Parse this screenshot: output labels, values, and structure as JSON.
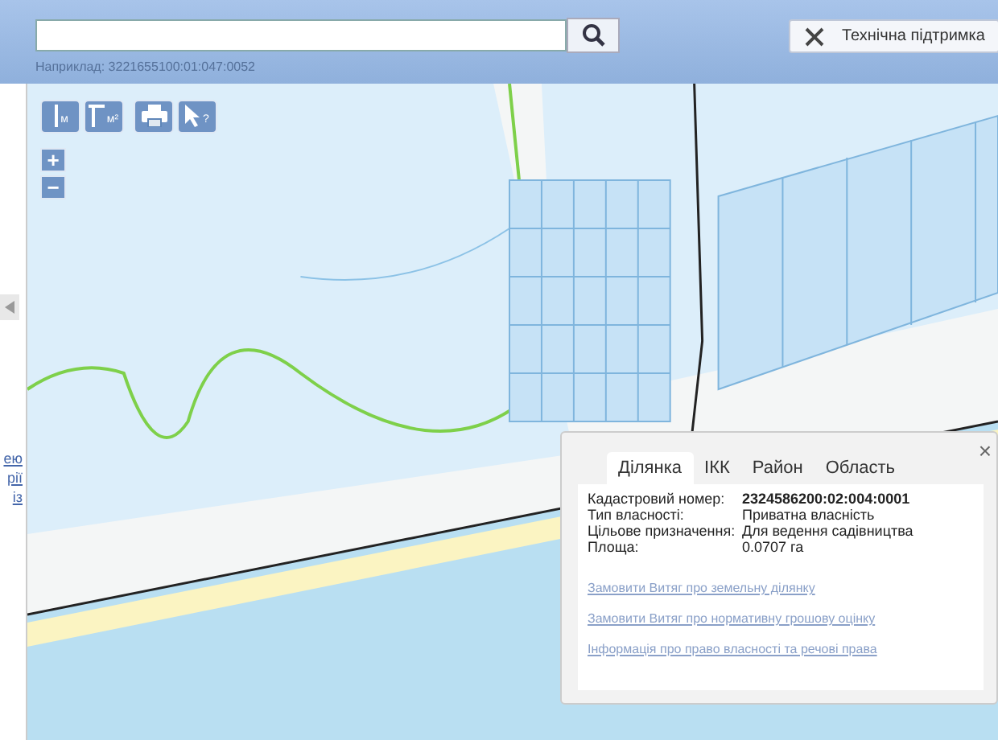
{
  "search": {
    "hint": "Наприклад: 3221655100:01:047:0052"
  },
  "support_button": "Технічна підтримка",
  "side_links": [
    "ею",
    "рії",
    "із"
  ],
  "tools": [
    {
      "kind": "measure-line",
      "label": "м"
    },
    {
      "kind": "measure-area",
      "label": "м²"
    },
    {
      "kind": "print"
    },
    {
      "kind": "identify",
      "label": "?"
    }
  ],
  "zoom": [
    "+",
    "−"
  ],
  "popup": {
    "close": "×",
    "tabs": [
      {
        "label": "Ділянка",
        "selected": true
      },
      {
        "label": "ІКК",
        "selected": false
      },
      {
        "label": "Район",
        "selected": false
      },
      {
        "label": "Область",
        "selected": false
      }
    ],
    "fields": [
      {
        "label": "Кадастровий номер:",
        "value": "2324586200:02:004:0001",
        "bold": true
      },
      {
        "label": "Тип власності:",
        "value": "Приватна власність",
        "bold": false
      },
      {
        "label": "Цільове призначення:",
        "value": "Для ведення садівництва",
        "bold": false
      },
      {
        "label": "Площа:",
        "value": "0.0707 га",
        "bold": false
      }
    ],
    "links": [
      "Замовити Витяг про земельну ділянку",
      "Замовити Витяг про нормативну грошову оцінку",
      "Інформація про право власності та речові права"
    ]
  }
}
